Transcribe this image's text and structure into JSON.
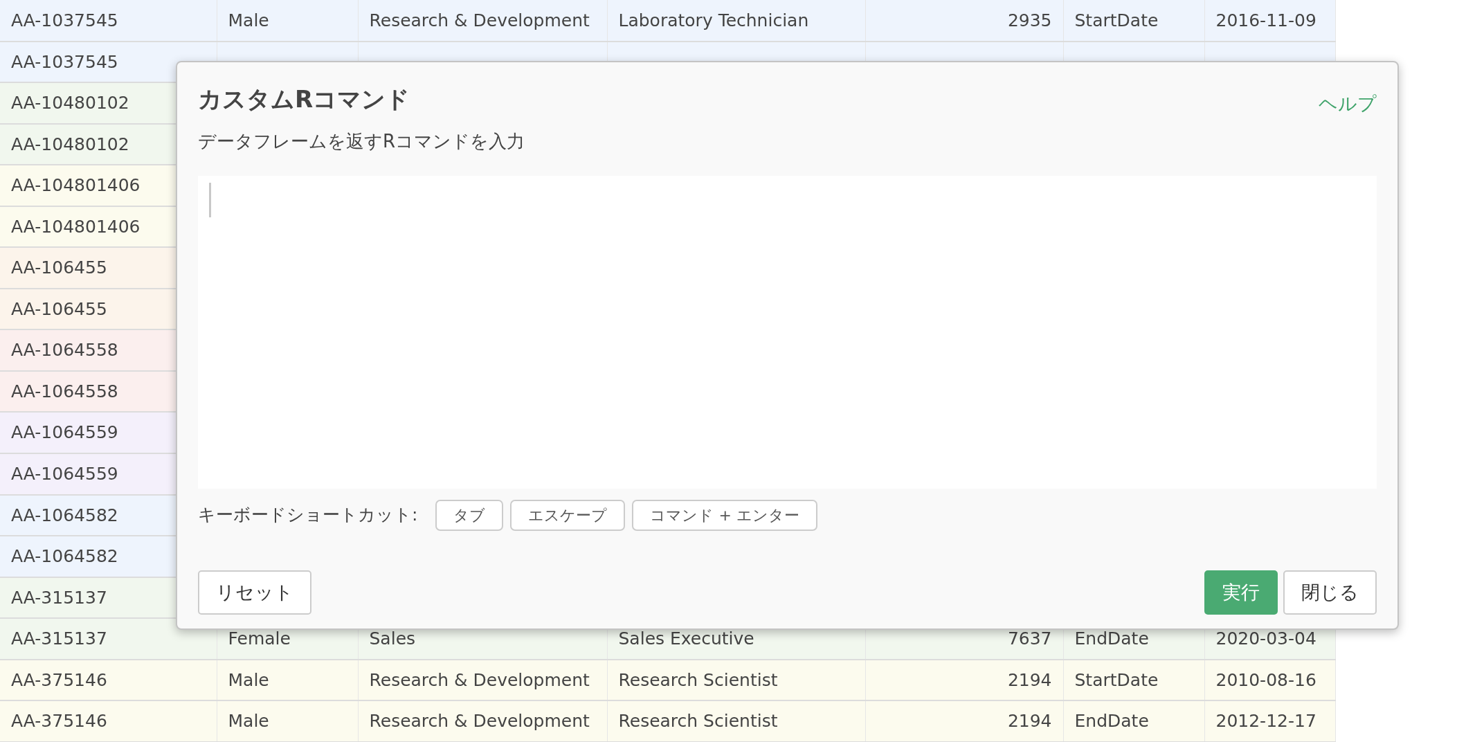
{
  "table": {
    "rows": [
      {
        "color": "#eef4fd",
        "cells": [
          "AA-1037545",
          "Male",
          "Research & Development",
          "Laboratory Technician",
          "2935",
          "StartDate",
          "2016-11-09"
        ]
      },
      {
        "color": "#eef4fd",
        "cells": [
          "AA-1037545"
        ]
      },
      {
        "color": "#f1f7ee",
        "cells": [
          "AA-10480102"
        ]
      },
      {
        "color": "#f1f7ee",
        "cells": [
          "AA-10480102"
        ]
      },
      {
        "color": "#fcfbee",
        "cells": [
          "AA-104801406"
        ]
      },
      {
        "color": "#fcfbee",
        "cells": [
          "AA-104801406"
        ]
      },
      {
        "color": "#fcf4eb",
        "cells": [
          "AA-106455"
        ]
      },
      {
        "color": "#fcf4eb",
        "cells": [
          "AA-106455"
        ]
      },
      {
        "color": "#fbefee",
        "cells": [
          "AA-1064558"
        ]
      },
      {
        "color": "#fbefee",
        "cells": [
          "AA-1064558"
        ]
      },
      {
        "color": "#f4f0fb",
        "cells": [
          "AA-1064559"
        ]
      },
      {
        "color": "#f4f0fb",
        "cells": [
          "AA-1064559"
        ]
      },
      {
        "color": "#eef4fd",
        "cells": [
          "AA-1064582"
        ]
      },
      {
        "color": "#eef4fd",
        "cells": [
          "AA-1064582"
        ]
      },
      {
        "color": "#f1f7ee",
        "cells": [
          "AA-315137"
        ]
      },
      {
        "color": "#f1f7ee",
        "cells": [
          "AA-315137",
          "Female",
          "Sales",
          "Sales Executive",
          "7637",
          "EndDate",
          "2020-03-04"
        ]
      },
      {
        "color": "#fcfbee",
        "cells": [
          "AA-375146",
          "Male",
          "Research & Development",
          "Research Scientist",
          "2194",
          "StartDate",
          "2010-08-16"
        ]
      },
      {
        "color": "#fcfbee",
        "cells": [
          "AA-375146",
          "Male",
          "Research & Development",
          "Research Scientist",
          "2194",
          "EndDate",
          "2012-12-17"
        ]
      }
    ]
  },
  "dialog": {
    "title": "カスタムRコマンド",
    "help_link": "ヘルプ",
    "subtitle": "データフレームを返すRコマンドを入力",
    "shortcuts": {
      "label": "キーボードショートカット:",
      "keys": [
        "タブ",
        "エスケープ",
        "コマンド + エンター"
      ]
    },
    "footer": {
      "left_buttons": [
        {
          "label": "リセット",
          "kind": "secondary"
        }
      ],
      "right_buttons": [
        {
          "label": "実行",
          "kind": "primary"
        },
        {
          "label": "閉じる",
          "kind": "secondary"
        }
      ]
    }
  }
}
